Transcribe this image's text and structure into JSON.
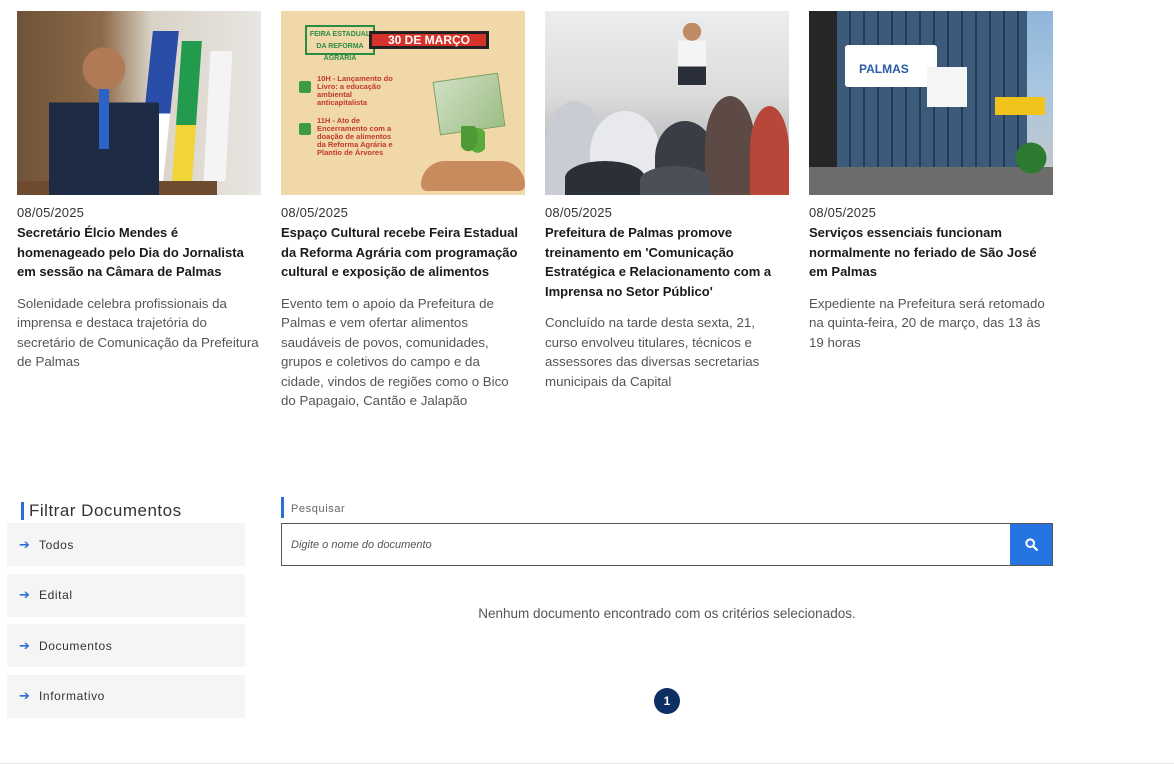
{
  "news": [
    {
      "date": "08/05/2025",
      "title": "Secretário Élcio Mendes é homenageado pelo Dia do Jornalista em sessão na Câmara de Palmas",
      "summary": "Solenidade celebra profissionais da imprensa e destaca trajetória do secretário de Comunicação da Prefeitura de Palmas"
    },
    {
      "date": "08/05/2025",
      "title": "Espaço Cultural recebe Feira Estadual da Reforma Agrária com programação cultural e exposição de alimentos",
      "summary": "Evento tem o apoio da Prefeitura de Palmas e vem ofertar alimentos saudáveis de povos, comunidades, grupos e coletivos do campo e da cidade, vindos de regiões como o Bico do Papagaio, Cantão e Jalapão",
      "poster": {
        "logo": "FEIRA ESTADUAL DA REFORMA AGRÁRIA",
        "banner": "30 DE MARÇO",
        "event1": "10H - Lançamento do Livro: a educação ambiental anticapitalista",
        "event2": "11H - Ato de Encerramento com a doação de alimentos da Reforma Agrária e Plantio de Árvores"
      }
    },
    {
      "date": "08/05/2025",
      "title": "Prefeitura de Palmas promove treinamento em 'Comunicação Estratégica e Relacionamento com a Imprensa no Setor Público'",
      "summary": "Concluído na tarde desta sexta, 21, curso envolveu titulares, técnicos e assessores das diversas secretarias municipais da Capital"
    },
    {
      "date": "08/05/2025",
      "title": "Serviços essenciais funcionam normalmente no feriado de São José em Palmas",
      "summary": "Expediente na Prefeitura será retomado na quinta-feira, 20 de março, das 13 às 19 horas",
      "sign_text": "PALMAS"
    }
  ],
  "filter": {
    "title": "Filtrar Documentos",
    "items": [
      {
        "label": "Todos",
        "icon": "arrow-right-icon"
      },
      {
        "label": "Edital",
        "icon": "arrow-right-icon"
      },
      {
        "label": "Documentos",
        "icon": "arrow-right-icon"
      },
      {
        "label": "Informativo",
        "icon": "arrow-right-icon"
      }
    ]
  },
  "search": {
    "label": "Pesquisar",
    "placeholder": "Digite o nome do documento",
    "button_icon": "search-icon"
  },
  "results": {
    "empty_message": "Nenhum documento encontrado com os critérios selecionados."
  },
  "pagination": {
    "current_page": "1"
  },
  "colors": {
    "accent": "#2574e0",
    "pager": "#0d2f63",
    "filter_bg": "#f5f5f5"
  }
}
